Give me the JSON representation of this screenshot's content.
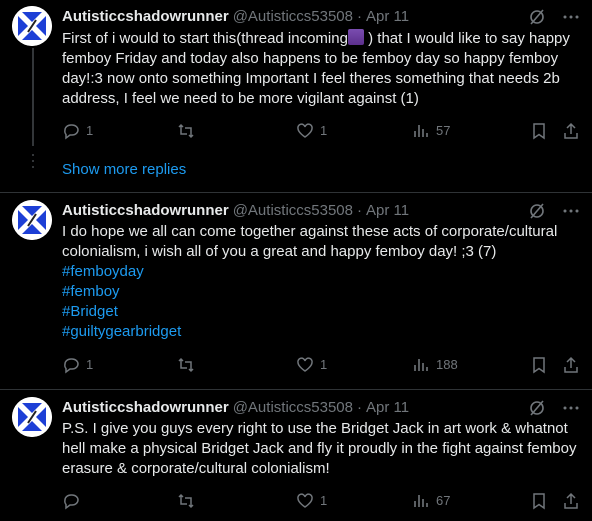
{
  "tweets": [
    {
      "name": "Autisticcshadowrunner",
      "handle": "@Autisticcs53508",
      "dot": "·",
      "date": "Apr 11",
      "text_before_emoji": "First of i would to start this(thread incoming",
      "emoji": "spool-of-thread-emoji",
      "text_after_emoji": " ) that I would like to say happy femboy Friday and today also happens to be femboy day so happy femboy day!:3 now onto something Important I feel theres something that needs 2b address, I feel we need to be more vigilant against (1)",
      "replies": "1",
      "retweets": "",
      "likes": "1",
      "views": "57"
    },
    {
      "name": "Autisticcshadowrunner",
      "handle": "@Autisticcs53508",
      "dot": "·",
      "date": "Apr 11",
      "text": "I do hope we all can come together against these acts of corporate/cultural colonialism, i wish all of you a great and happy femboy day! ;3 (7)",
      "hashtags": [
        "#femboyday",
        "#femboy",
        "#Bridget",
        "#guiltygearbridget"
      ],
      "replies": "1",
      "retweets": "",
      "likes": "1",
      "views": "188"
    },
    {
      "name": "Autisticcshadowrunner",
      "handle": "@Autisticcs53508",
      "dot": "·",
      "date": "Apr 11",
      "text": "P.S. I give you guys every right to use the Bridget Jack in art work & whatnot hell make a physical Bridget Jack and fly it proudly in the fight against femboy erasure & corporate/cultural colonialism!",
      "replies": "",
      "retweets": "",
      "likes": "1",
      "views": "67"
    }
  ],
  "show_more_replies": "Show more replies",
  "colors": {
    "background": "#000000",
    "text": "#e7e9ea",
    "muted": "#71767b",
    "link": "#1d9bf0"
  },
  "icons": [
    "grok-icon",
    "more-icon",
    "reply-icon",
    "retweet-icon",
    "like-icon",
    "views-icon",
    "bookmark-icon",
    "share-icon"
  ]
}
